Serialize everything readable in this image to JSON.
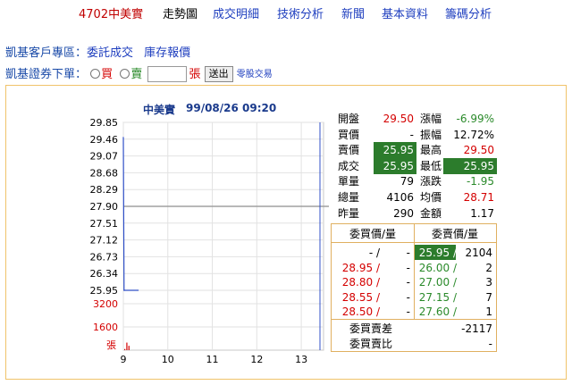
{
  "nav": {
    "title": "4702中美實",
    "items": [
      "走勢圖",
      "成交明細",
      "技術分析",
      "新聞",
      "基本資料",
      "籌碼分析"
    ]
  },
  "client": {
    "label": "凱基客戶專區：",
    "link1": "委託成交",
    "link2": "庫存報價"
  },
  "order": {
    "label": "凱基證券下單：",
    "buy": "買",
    "sell": "賣",
    "unit": "張",
    "send": "送出",
    "odd_lot": "零股交易"
  },
  "chart": {
    "stock_name": "中美實",
    "timestamp": "99/08/26 09:20"
  },
  "chart_data": {
    "type": "line",
    "price_ticks": [
      29.85,
      29.46,
      29.07,
      28.68,
      28.29,
      27.9,
      27.51,
      27.12,
      26.73,
      26.34,
      25.95
    ],
    "reference_price": 27.9,
    "volume_ticks": [
      3200,
      1600
    ],
    "volume_unit": "張",
    "x_ticks": [
      "9",
      "10",
      "11",
      "12",
      "13"
    ],
    "series": [
      {
        "x": [
          "09:00",
          "09:01",
          "09:02",
          "09:20"
        ],
        "values": [
          29.5,
          25.95,
          25.95,
          25.95
        ]
      }
    ],
    "volume": {
      "x": [
        "09:00",
        "09:01",
        "09:02"
      ],
      "values": [
        79,
        520,
        300
      ]
    },
    "ylim": [
      25.95,
      29.85
    ],
    "xlim": [
      "09:00",
      "13:30"
    ]
  },
  "quote": {
    "left": [
      {
        "label": "開盤",
        "value": "29.50",
        "color": "red"
      },
      {
        "label": "買價",
        "value": "-",
        "color": ""
      },
      {
        "label": "賣價",
        "value": "25.95",
        "color": "hl"
      },
      {
        "label": "成交",
        "value": "25.95",
        "color": "hl"
      },
      {
        "label": "單量",
        "value": "79",
        "color": ""
      },
      {
        "label": "總量",
        "value": "4106",
        "color": ""
      },
      {
        "label": "昨量",
        "value": "290",
        "color": ""
      }
    ],
    "right": [
      {
        "label": "漲幅",
        "value": "-6.99%",
        "color": "green"
      },
      {
        "label": "振幅",
        "value": "12.72%",
        "color": ""
      },
      {
        "label": "最高",
        "value": "29.50",
        "color": "red"
      },
      {
        "label": "最低",
        "value": "25.95",
        "color": "hl"
      },
      {
        "label": "漲跌",
        "value": "-1.95",
        "color": "green"
      },
      {
        "label": "均價",
        "value": "28.71",
        "color": "red"
      },
      {
        "label": "金額",
        "value": "1.17",
        "color": ""
      }
    ]
  },
  "book": {
    "bid_header": "委買價/量",
    "ask_header": "委賣價/量",
    "rows": [
      {
        "bid_price": "-",
        "bid_qty": "-",
        "ask_price": "25.95",
        "ask_qty": "2104"
      },
      {
        "bid_price": "28.95",
        "bid_qty": "-",
        "ask_price": "26.00",
        "ask_qty": "2"
      },
      {
        "bid_price": "28.80",
        "bid_qty": "-",
        "ask_price": "27.00",
        "ask_qty": "3"
      },
      {
        "bid_price": "28.55",
        "bid_qty": "-",
        "ask_price": "27.15",
        "ask_qty": "7"
      },
      {
        "bid_price": "28.50",
        "bid_qty": "-",
        "ask_price": "27.60",
        "ask_qty": "1"
      }
    ],
    "diff_label": "委買賣差",
    "diff_value": "-2117",
    "ratio_label": "委買賣比",
    "ratio_value": "-"
  },
  "colors": {
    "up": "#d40000",
    "down": "#2a8a2a",
    "line": "#3050c8",
    "highlight": "#2c7c2c",
    "border": "#f0c36a"
  }
}
